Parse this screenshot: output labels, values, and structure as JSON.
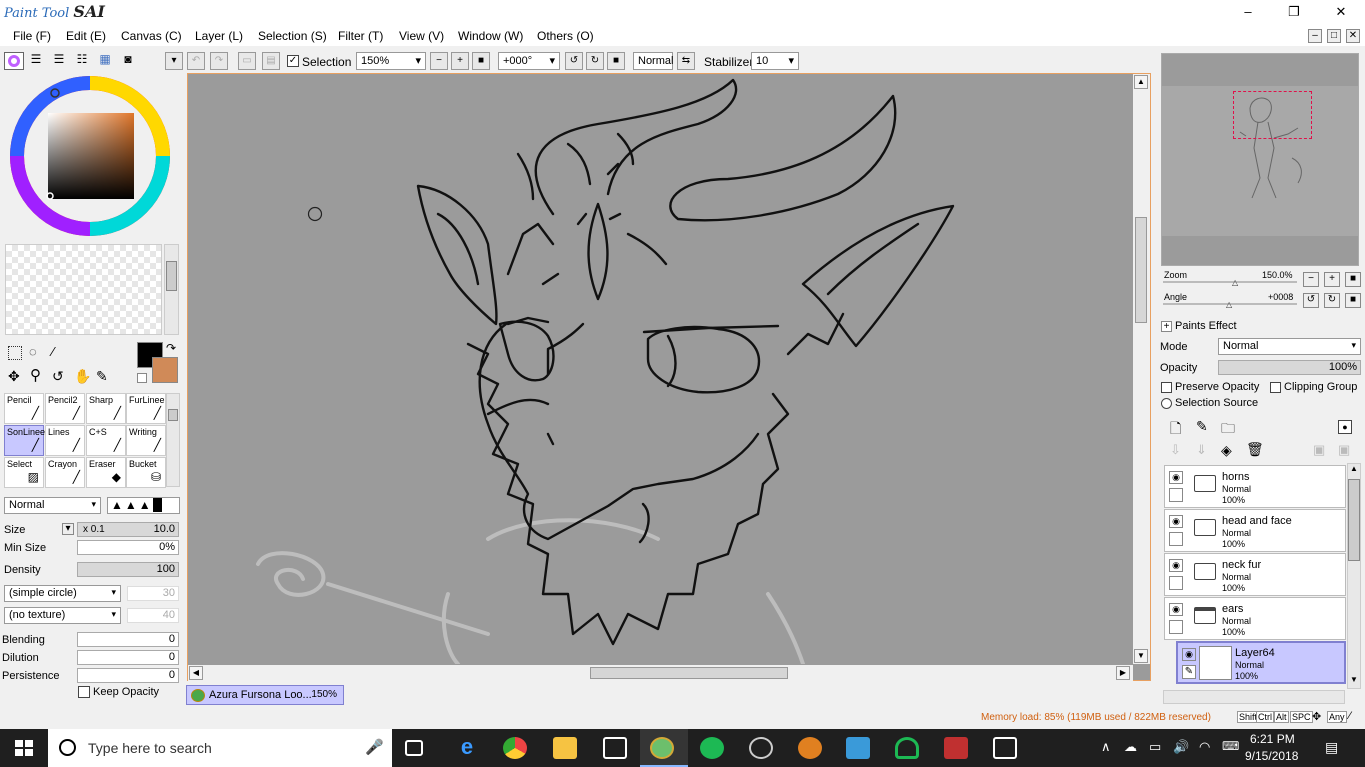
{
  "app": {
    "logo_small": "Paint Tool",
    "logo_big": "SAI",
    "minimize": "–",
    "maximize": "❐",
    "close": "✕"
  },
  "menu": [
    "File (F)",
    "Edit (E)",
    "Canvas (C)",
    "Layer (L)",
    "Selection (S)",
    "Filter (T)",
    "View (V)",
    "Window (W)",
    "Others (O)"
  ],
  "toolbar": {
    "selection_label": "Selection",
    "zoom": "150%",
    "rotation": "+000°",
    "blend": "Normal",
    "stabilizer_label": "Stabilizer",
    "stabilizer_value": "10"
  },
  "brushes": [
    {
      "label": "Pencil"
    },
    {
      "label": "Pencil2"
    },
    {
      "label": "Sharp"
    },
    {
      "label": "FurLinee"
    },
    {
      "label": "SonLinee"
    },
    {
      "label": "Lines"
    },
    {
      "label": "C+S"
    },
    {
      "label": "Writing"
    },
    {
      "label": "Select"
    },
    {
      "label": "Crayon"
    },
    {
      "label": "Eraser"
    },
    {
      "label": "Bucket"
    }
  ],
  "brush_settings": {
    "blend_mode": "Normal",
    "size_label": "Size",
    "size_mult": "x 0.1",
    "size_value": "10.0",
    "min_size_label": "Min Size",
    "min_size_value": "0%",
    "density_label": "Density",
    "density_value": "100",
    "shape": "(simple circle)",
    "shape_value": "30",
    "texture": "(no texture)",
    "texture_value": "40",
    "blending_label": "Blending",
    "blending_value": "0",
    "dilution_label": "Dilution",
    "dilution_value": "0",
    "persistence_label": "Persistence",
    "persistence_value": "0",
    "keep_opacity_label": "Keep Opacity"
  },
  "colors": {
    "primary": "#000000",
    "secondary": "#d08a58",
    "accent": "#c8c8ff",
    "canvas_bg": "#9b9b9b"
  },
  "navigator": {
    "zoom_label": "Zoom",
    "zoom_value": "150.0%",
    "angle_label": "Angle",
    "angle_value": "+0008"
  },
  "layer_panel": {
    "paints_effect": "Paints Effect",
    "mode_label": "Mode",
    "mode_value": "Normal",
    "opacity_label": "Opacity",
    "opacity_value": "100%",
    "preserve_opacity": "Preserve Opacity",
    "clipping_group": "Clipping Group",
    "selection_source": "Selection Source"
  },
  "layers": [
    {
      "name": "horns",
      "mode": "Normal",
      "opacity": "100%",
      "type": "folder"
    },
    {
      "name": "head and face",
      "mode": "Normal",
      "opacity": "100%",
      "type": "folder"
    },
    {
      "name": "neck fur",
      "mode": "Normal",
      "opacity": "100%",
      "type": "folder"
    },
    {
      "name": "ears",
      "mode": "Normal",
      "opacity": "100%",
      "type": "folder-open"
    },
    {
      "name": "Layer64",
      "mode": "Normal",
      "opacity": "100%",
      "type": "layer",
      "selected": true
    }
  ],
  "doc_tab": {
    "title": "Azura Fursona Loo...",
    "zoom": "150%"
  },
  "status": {
    "memory": "Memory load: 85% (119MB used / 822MB reserved)",
    "keys": [
      "Shift",
      "Ctrl",
      "Alt",
      "SPC",
      "Any"
    ]
  },
  "taskbar": {
    "search_placeholder": "Type here to search",
    "time": "6:21 PM",
    "date": "9/15/2018"
  }
}
